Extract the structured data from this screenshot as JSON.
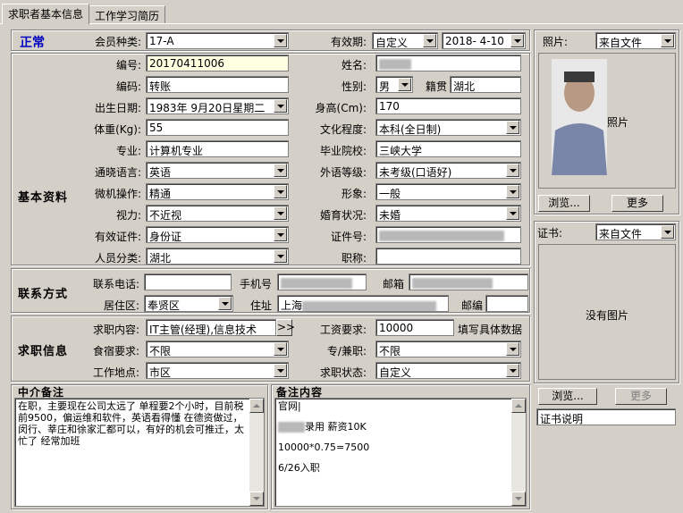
{
  "tabs": [
    {
      "label": "求职者基本信息"
    },
    {
      "label": "工作学习简历"
    }
  ],
  "status": {
    "text": "正常",
    "color": "#0000c0"
  },
  "membership": {
    "label": "会员种类:",
    "value": "17-A"
  },
  "validity": {
    "label": "有效期:",
    "type": "自定义",
    "date": "2018- 4-10"
  },
  "sections": {
    "basic": "基本资料",
    "contact": "联系方式",
    "job": "求职信息"
  },
  "basic": {
    "serial": {
      "label": "编号:",
      "value": "20170411006"
    },
    "name": {
      "label": "姓名:"
    },
    "code": {
      "label": "编码:",
      "value": "转账"
    },
    "gender": {
      "label": "性别:",
      "value": "男"
    },
    "origin": {
      "label": "籍贯",
      "value": "湖北"
    },
    "birth": {
      "label": "出生日期:",
      "value": "1983年 9月20日星期二"
    },
    "height": {
      "label": "身高(Cm):",
      "value": "170"
    },
    "weight": {
      "label": "体重(Kg):",
      "value": "55"
    },
    "education": {
      "label": "文化程度:",
      "value": "本科(全日制)"
    },
    "major": {
      "label": "专业:",
      "value": "计算机专业"
    },
    "school": {
      "label": "毕业院校:",
      "value": "三峡大学"
    },
    "language": {
      "label": "通晓语言:",
      "value": "英语"
    },
    "lang_level": {
      "label": "外语等级:",
      "value": "未考级(口语好)"
    },
    "computer": {
      "label": "微机操作:",
      "value": "精通"
    },
    "appearance": {
      "label": "形象:",
      "value": "一般"
    },
    "vision": {
      "label": "视力:",
      "value": "不近视"
    },
    "marital": {
      "label": "婚育状况:",
      "value": "未婚"
    },
    "id_type": {
      "label": "有效证件:",
      "value": "身份证"
    },
    "id_no": {
      "label": "证件号:"
    },
    "category": {
      "label": "人员分类:",
      "value": "湖北"
    },
    "title": {
      "label": "职称:",
      "value": ""
    }
  },
  "contact": {
    "phone": {
      "label": "联系电话:",
      "value": ""
    },
    "mobile": {
      "label": "手机号"
    },
    "email": {
      "label": "邮箱"
    },
    "district": {
      "label": "居住区:",
      "value": "奉贤区"
    },
    "address": {
      "label": "住址",
      "value": "上海"
    },
    "zip": {
      "label": "邮编",
      "value": ""
    }
  },
  "job": {
    "position": {
      "label": "求职内容:",
      "value": "IT主管(经理),信息技术"
    },
    "more": ">>",
    "salary": {
      "label": "工资要求:",
      "value": "10000",
      "hint": "填写具体数据"
    },
    "board": {
      "label": "食宿要求:",
      "value": "不限"
    },
    "fulltime": {
      "label": "专/兼职:",
      "value": "不限"
    },
    "location": {
      "label": "工作地点:",
      "value": "市区"
    },
    "state": {
      "label": "求职状态:",
      "value": "自定义"
    }
  },
  "agent_note": {
    "label": "中介备注",
    "text": "在职，主要现在公司太远了  单程要2个小时，目前税前9500，偏运维和软件，英语看得懂  在德资做过，闵行、莘庄和徐家汇都可以，有好的机会可推迁，太忙了  经常加班"
  },
  "remark": {
    "label": "备注内容",
    "lines": [
      "官网|",
      "录用 薪资10K",
      "10000*0.75=7500",
      "6/26入职"
    ]
  },
  "photo": {
    "label": "照片:",
    "source": "来自文件",
    "caption": "照片",
    "browse": "浏览...",
    "more": "更多"
  },
  "cert": {
    "label": "证书:",
    "source": "来自文件",
    "empty": "没有图片",
    "browse": "浏览...",
    "more": "更多",
    "desc": "证书说明"
  }
}
